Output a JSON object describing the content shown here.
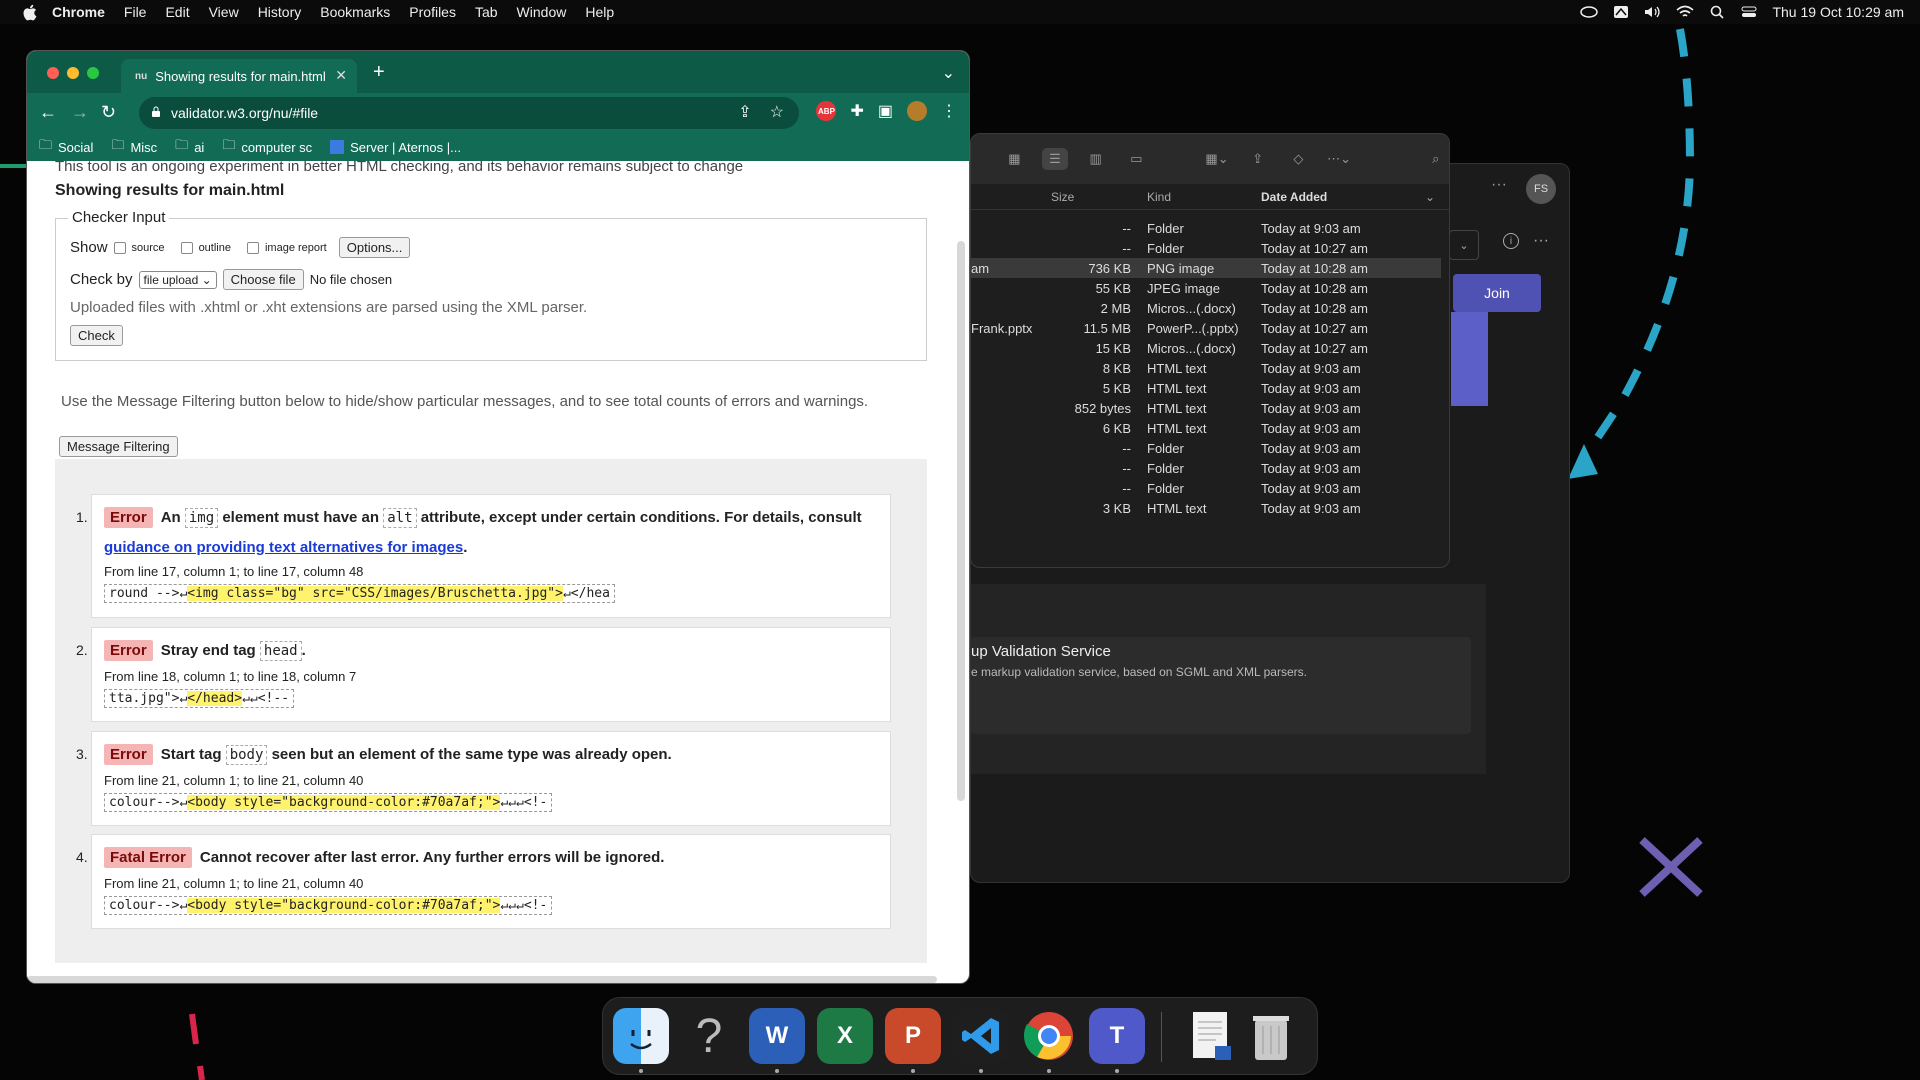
{
  "menubar": {
    "app": "Chrome",
    "items": [
      "File",
      "Edit",
      "View",
      "History",
      "Bookmarks",
      "Profiles",
      "Tab",
      "Window",
      "Help"
    ],
    "datetime": "Thu 19 Oct  10:29 am"
  },
  "browser": {
    "tab_title": "Showing results for main.html",
    "tab_favicon": "nu",
    "url": "validator.w3.org/nu/#file",
    "abp_label": "ABP",
    "bookmarks": [
      "Social",
      "Misc",
      "ai",
      "computer sc",
      "Server | Aternos |..."
    ]
  },
  "page": {
    "notice": "This tool is an ongoing experiment in better HTML checking, and its behavior remains subject to change",
    "heading": "Showing results for main.html",
    "checker_input": {
      "legend": "Checker Input",
      "show_label": "Show",
      "options": [
        "source",
        "outline",
        "image report"
      ],
      "options_button": "Options...",
      "check_by_label": "Check by",
      "check_by_value": "file upload",
      "choose_file": "Choose file",
      "no_file": "No file chosen",
      "note": "Uploaded files with .xhtml or .xht extensions are parsed using the XML parser.",
      "check_button": "Check"
    },
    "filter_note": "Use the Message Filtering button below to hide/show particular messages, and to see total counts of errors and warnings.",
    "filter_button": "Message Filtering",
    "messages": [
      {
        "num": "1.",
        "type": "Error",
        "pre": "An",
        "code1": "img",
        "mid": "element must have an",
        "code2": "alt",
        "post": "attribute, except under certain conditions. For details, consult",
        "link": "guidance on providing text alternatives for images",
        "end": ".",
        "location": "From line 17, column 1; to line 17, column 48",
        "extract_pre": "round -->↵",
        "extract_hl": "<img class=\"bg\" src=\"CSS/images/Bruschetta.jpg\">",
        "extract_post": "↵</hea"
      },
      {
        "num": "2.",
        "type": "Error",
        "pre": "Stray end tag",
        "code1": "head",
        "post": ".",
        "location": "From line 18, column 1; to line 18, column 7",
        "extract_pre": "tta.jpg\">↵",
        "extract_hl": "</head>",
        "extract_post": "↵↵<!--"
      },
      {
        "num": "3.",
        "type": "Error",
        "pre": "Start tag",
        "code1": "body",
        "post": "seen but an element of the same type was already open.",
        "location": "From line 21, column 1; to line 21, column 40",
        "extract_pre": "colour-->↵",
        "extract_hl": "<body style=\"background-color:#70a7af;\">",
        "extract_post": "↵↵↵<!-"
      },
      {
        "num": "4.",
        "type": "Fatal Error",
        "post": "Cannot recover after last error. Any further errors will be ignored.",
        "location": "From line 21, column 1; to line 21, column 40",
        "extract_pre": "colour-->↵",
        "extract_hl": "<body style=\"background-color:#70a7af;\">",
        "extract_post": "↵↵↵<!-"
      }
    ]
  },
  "finder": {
    "columns": [
      "Size",
      "Kind",
      "Date Added"
    ],
    "rows": [
      {
        "name": "",
        "size": "--",
        "kind": "Folder",
        "date": "Today at 9:03 am"
      },
      {
        "name": "",
        "size": "--",
        "kind": "Folder",
        "date": "Today at 10:27 am"
      },
      {
        "name": "am",
        "size": "736 KB",
        "kind": "PNG image",
        "date": "Today at 10:28 am"
      },
      {
        "name": "",
        "size": "55 KB",
        "kind": "JPEG image",
        "date": "Today at 10:28 am"
      },
      {
        "name": "",
        "size": "2 MB",
        "kind": "Micros...(.docx)",
        "date": "Today at 10:28 am"
      },
      {
        "name": "Frank.pptx",
        "size": "11.5 MB",
        "kind": "PowerP...(.pptx)",
        "date": "Today at 10:27 am"
      },
      {
        "name": "",
        "size": "15 KB",
        "kind": "Micros...(.docx)",
        "date": "Today at 10:27 am"
      },
      {
        "name": "",
        "size": "8 KB",
        "kind": "HTML text",
        "date": "Today at 9:03 am"
      },
      {
        "name": "",
        "size": "5 KB",
        "kind": "HTML text",
        "date": "Today at 9:03 am"
      },
      {
        "name": "",
        "size": "852 bytes",
        "kind": "HTML text",
        "date": "Today at 9:03 am"
      },
      {
        "name": "",
        "size": "6 KB",
        "kind": "HTML text",
        "date": "Today at 9:03 am"
      },
      {
        "name": "",
        "size": "--",
        "kind": "Folder",
        "date": "Today at 9:03 am"
      },
      {
        "name": "",
        "size": "--",
        "kind": "Folder",
        "date": "Today at 9:03 am"
      },
      {
        "name": "",
        "size": "--",
        "kind": "Folder",
        "date": "Today at 9:03 am"
      },
      {
        "name": "",
        "size": "3 KB",
        "kind": "HTML text",
        "date": "Today at 9:03 am"
      }
    ]
  },
  "teams": {
    "join": "Join",
    "avatar": "FS",
    "card_title": "up Validation Service",
    "card_sub": "e markup validation service, based on SGML and XML parsers."
  },
  "dock": {
    "apps": [
      "finder",
      "help",
      "word",
      "excel",
      "powerpoint",
      "vscode",
      "chrome",
      "teams",
      "document",
      "trash"
    ],
    "labels": {
      "word": "W",
      "excel": "X",
      "powerpoint": "P",
      "teams": "T",
      "help": "?"
    }
  },
  "colors": {
    "chrome_frame": "#126b55",
    "error_badge": "#f5b5b5",
    "highlight": "#fff36e",
    "link": "#1a3bd6"
  }
}
